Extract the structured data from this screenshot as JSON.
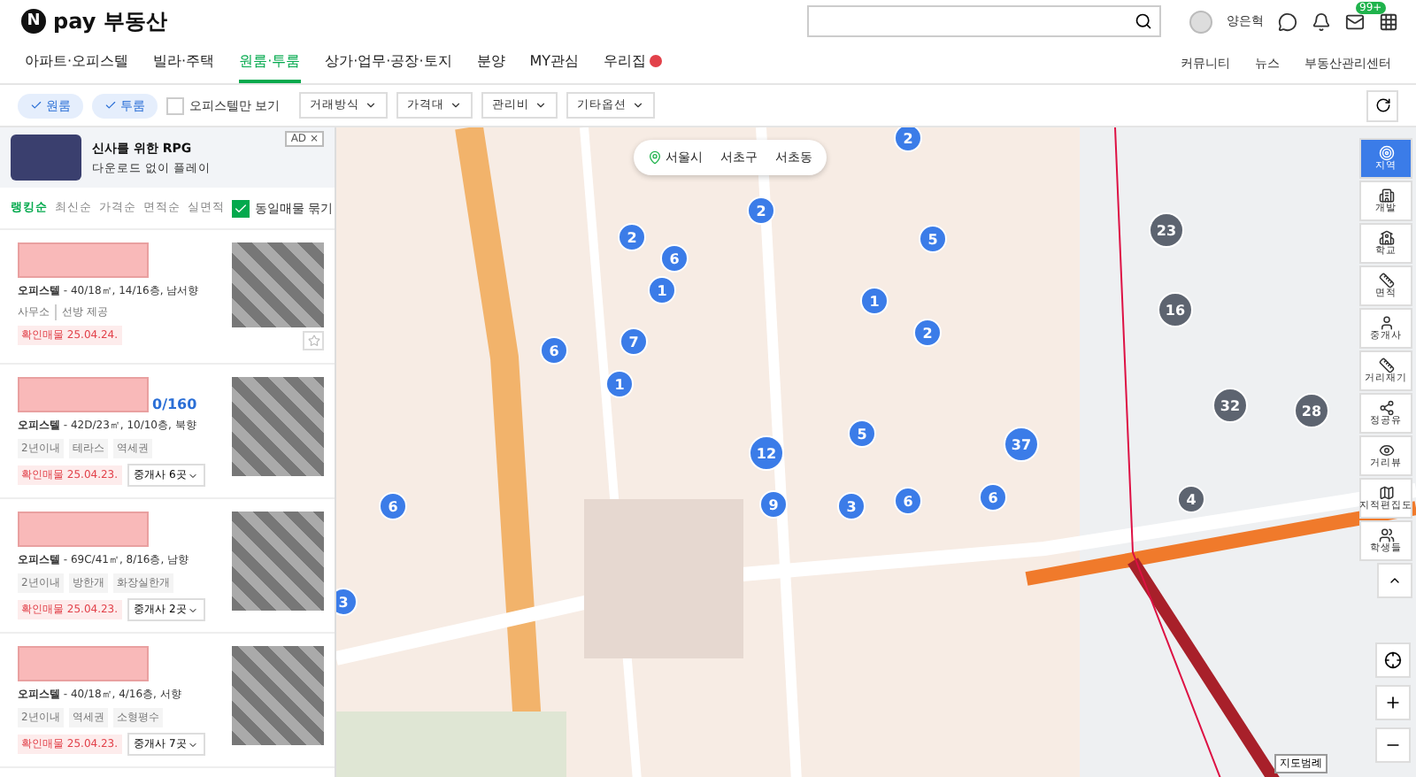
{
  "header": {
    "logo": "pay 부동산",
    "logo_mark": "N",
    "user": "양은혁",
    "mail_badge": "99+"
  },
  "nav": {
    "tabs": [
      {
        "label": "아파트·오피스텔",
        "selected": false,
        "badge": false
      },
      {
        "label": "빌라·주택",
        "selected": false,
        "badge": false
      },
      {
        "label": "원룸·투룸",
        "selected": true,
        "badge": false
      },
      {
        "label": "상가·업무·공장·토지",
        "selected": false,
        "badge": false
      },
      {
        "label": "분양",
        "selected": false,
        "badge": false
      },
      {
        "label": "MY관심",
        "selected": false,
        "badge": false
      },
      {
        "label": "우리집",
        "selected": false,
        "badge": true
      }
    ],
    "links": [
      "커뮤니티",
      "뉴스",
      "부동산관리센터"
    ]
  },
  "filters": {
    "chips": [
      {
        "label": "원룸",
        "selected": true
      },
      {
        "label": "투룸",
        "selected": true
      }
    ],
    "officetel_only": {
      "label": "오피스텔만 보기",
      "checked": false
    },
    "dropdowns": [
      "거래방식",
      "가격대",
      "관리비",
      "기타옵션"
    ]
  },
  "ad": {
    "tag": "AD",
    "close": "×",
    "title": "신사를 위한 RPG",
    "subtitle": "다운로드 없이 플레이"
  },
  "sort": {
    "options": [
      {
        "label": "랭킹순",
        "selected": true
      },
      {
        "label": "최신순",
        "selected": false
      },
      {
        "label": "가격순",
        "selected": false
      },
      {
        "label": "면적순",
        "selected": false
      },
      {
        "label": "실면적",
        "selected": false
      }
    ],
    "group_same": {
      "label": "동일매물 묶기",
      "checked": true
    }
  },
  "listings": [
    {
      "spec_type": "오피스텔",
      "spec": " - 40/18㎡, 14/16층, 남서향",
      "agency": "사무소",
      "photo_credit": "선방 제공",
      "verified": "확인매물 25.04.24."
    },
    {
      "price_tail": "0/160",
      "spec_type": "오피스텔",
      "spec": " - 42D/23㎡, 10/10층, 북향",
      "tags": [
        "2년이내",
        "테라스",
        "역세권"
      ],
      "verified": "확인매물 25.04.23.",
      "agents": "중개사 6곳"
    },
    {
      "spec_type": "오피스텔",
      "spec": " - 69C/41㎡, 8/16층, 남향",
      "tags": [
        "2년이내",
        "방한개",
        "화장실한개"
      ],
      "verified": "확인매물 25.04.23.",
      "agents": "중개사 2곳"
    },
    {
      "spec_type": "오피스텔",
      "spec": " - 40/18㎡, 4/16층, 서향",
      "tags": [
        "2년이내",
        "역세권",
        "소형평수"
      ],
      "verified": "확인매물 25.04.23.",
      "agents": "중개사 7곳"
    }
  ],
  "map": {
    "breadcrumb": [
      "서울시",
      "서초구",
      "서초동"
    ],
    "clusters": [
      {
        "count": "2",
        "kind": "listing"
      },
      {
        "count": "2",
        "kind": "listing"
      },
      {
        "count": "2",
        "kind": "listing"
      },
      {
        "count": "6",
        "kind": "listing"
      },
      {
        "count": "5",
        "kind": "listing"
      },
      {
        "count": "1",
        "kind": "listing"
      },
      {
        "count": "1",
        "kind": "listing"
      },
      {
        "count": "2",
        "kind": "listing"
      },
      {
        "count": "7",
        "kind": "listing"
      },
      {
        "count": "6",
        "kind": "listing"
      },
      {
        "count": "1",
        "kind": "listing"
      },
      {
        "count": "5",
        "kind": "listing"
      },
      {
        "count": "12",
        "kind": "listing"
      },
      {
        "count": "37",
        "kind": "listing"
      },
      {
        "count": "9",
        "kind": "listing"
      },
      {
        "count": "3",
        "kind": "listing"
      },
      {
        "count": "6",
        "kind": "listing"
      },
      {
        "count": "6",
        "kind": "listing"
      },
      {
        "count": "6",
        "kind": "listing"
      },
      {
        "count": "3",
        "kind": "listing"
      },
      {
        "count": "23",
        "kind": "other"
      },
      {
        "count": "16",
        "kind": "other"
      },
      {
        "count": "32",
        "kind": "other"
      },
      {
        "count": "28",
        "kind": "other"
      },
      {
        "count": "4",
        "kind": "other"
      }
    ],
    "tools": [
      {
        "label": "지역",
        "selected": true
      },
      {
        "label": "개발",
        "selected": false
      },
      {
        "label": "학교",
        "selected": false
      },
      {
        "label": "면적",
        "selected": false
      },
      {
        "label": "중개사",
        "selected": false
      },
      {
        "label": "거리재기",
        "selected": false
      },
      {
        "label": "정공유",
        "selected": false
      },
      {
        "label": "거리뷰",
        "selected": false
      },
      {
        "label": "지적편집도",
        "selected": false
      },
      {
        "label": "학생들",
        "selected": false
      }
    ],
    "scale": "지도범례"
  }
}
